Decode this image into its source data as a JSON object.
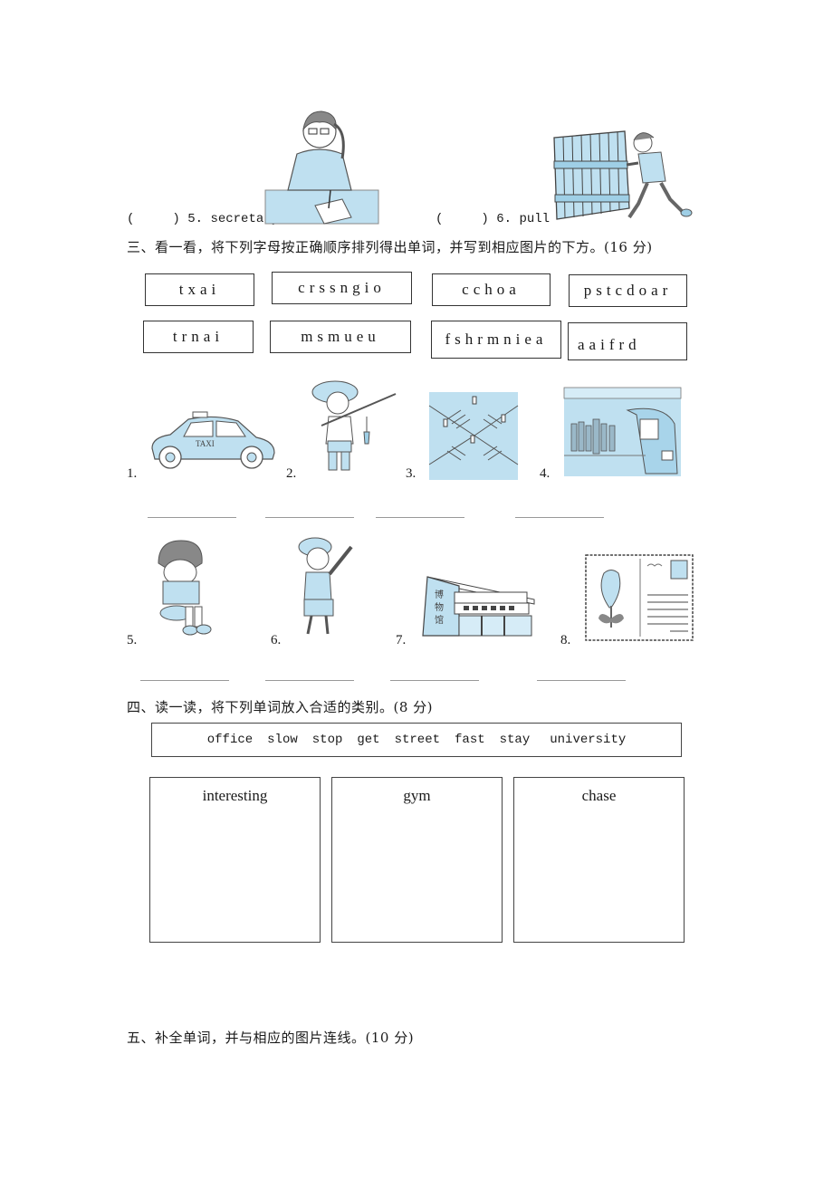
{
  "part_two_tail": {
    "items": [
      {
        "bracket": "(     )",
        "number": "5.",
        "word": "secretary",
        "picture": "secretary-on-phone"
      },
      {
        "bracket": "(     )",
        "number": "6.",
        "word": "pull",
        "picture": "man-pushing-crate"
      }
    ]
  },
  "part_three": {
    "heading": "三、看一看，将下列字母按正确顺序排列得出单词，并写到相应图片的下方。(16 分)",
    "scrambled_words": [
      "txai",
      "crssngio",
      "cchoa",
      "pstcdoar",
      "trnai",
      "msmueu",
      "fshrmniea",
      "aaifrd"
    ],
    "pictures": [
      {
        "number": "1.",
        "picture": "taxi",
        "taxi_label": "TAXI"
      },
      {
        "number": "2.",
        "picture": "fisherman-boy"
      },
      {
        "number": "3.",
        "picture": "crossing"
      },
      {
        "number": "4.",
        "picture": "train-station"
      },
      {
        "number": "5.",
        "picture": "afraid-child"
      },
      {
        "number": "6.",
        "picture": "coach-boy"
      },
      {
        "number": "7.",
        "picture": "museum",
        "museum_sign": "博物馆"
      },
      {
        "number": "8.",
        "picture": "postcard"
      }
    ]
  },
  "part_four": {
    "heading": "四、读一读，将下列单词放入合适的类别。(8 分)",
    "word_bank": [
      "office",
      "slow",
      "stop",
      "get",
      "street",
      "fast",
      "stay",
      "university"
    ],
    "categories": [
      "interesting",
      "gym",
      "chase"
    ]
  },
  "part_five": {
    "heading": "五、补全单词，并与相应的图片连线。(10 分)"
  },
  "colors": {
    "illustration_fill": "#bfe0f0",
    "illustration_stroke": "#555555",
    "border": "#333333",
    "blank_line": "#999999"
  }
}
